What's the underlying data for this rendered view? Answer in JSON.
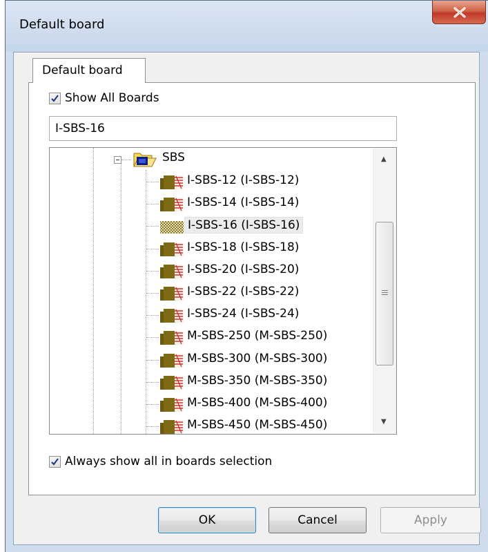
{
  "window": {
    "title": "Default board",
    "close_icon": "close-icon"
  },
  "tabs": [
    {
      "label": "Default board",
      "active": true
    }
  ],
  "show_all": {
    "label": "Show All Boards",
    "checked": true
  },
  "board_input": {
    "value": "I-SBS-16"
  },
  "tree": {
    "folder": {
      "label": "SBS",
      "expanded": true,
      "icon": "folder-icon"
    },
    "items": [
      {
        "label": "I-SBS-12 (I-SBS-12)",
        "selected": false
      },
      {
        "label": "I-SBS-14 (I-SBS-14)",
        "selected": false
      },
      {
        "label": "I-SBS-16 (I-SBS-16)",
        "selected": true
      },
      {
        "label": "I-SBS-18 (I-SBS-18)",
        "selected": false
      },
      {
        "label": "I-SBS-20 (I-SBS-20)",
        "selected": false
      },
      {
        "label": "I-SBS-22 (I-SBS-22)",
        "selected": false
      },
      {
        "label": "I-SBS-24 (I-SBS-24)",
        "selected": false
      },
      {
        "label": "M-SBS-250 (M-SBS-250)",
        "selected": false
      },
      {
        "label": "M-SBS-300 (M-SBS-300)",
        "selected": false
      },
      {
        "label": "M-SBS-350 (M-SBS-350)",
        "selected": false
      },
      {
        "label": "M-SBS-400 (M-SBS-400)",
        "selected": false
      },
      {
        "label": "M-SBS-450 (M-SBS-450)",
        "selected": false
      }
    ]
  },
  "always_show": {
    "label": "Always show all in boards selection",
    "checked": true
  },
  "buttons": {
    "ok": "OK",
    "cancel": "Cancel",
    "apply": "Apply"
  },
  "colors": {
    "window_frame": "#cfdcec",
    "close_button": "#c0392b",
    "board_icon": "#6b5a10"
  }
}
